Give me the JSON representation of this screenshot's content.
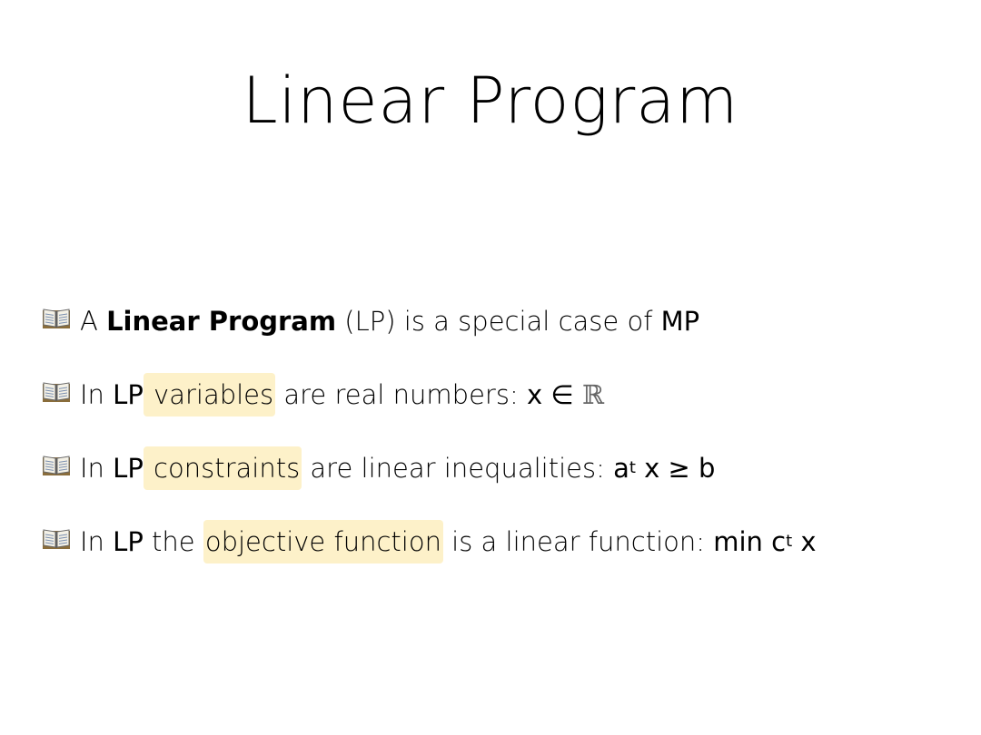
{
  "slide": {
    "title": "Linear Program",
    "bullet_icon": "open-book-icon",
    "highlight_color": "#fdf1c9",
    "bullets": [
      {
        "s1": "A ",
        "s2": "Linear Program",
        "s3": " (LP) is a special case of ",
        "s4": "MP"
      },
      {
        "s1": "In ",
        "s2": "LP",
        "s3": " variables",
        "s4": " are real numbers: ",
        "s5": "x ∈ ",
        "s6": "ℝ"
      },
      {
        "s1": "In ",
        "s2": "LP",
        "s3": " constraints",
        "s4": " are linear inequalities: ",
        "s5": "a",
        "s6": "t",
        "s7": " x ≥ b"
      },
      {
        "s1": "In ",
        "s2": "LP",
        "s3": " the ",
        "s4": "objective function",
        "s5": " is a linear function: ",
        "s6": "min c",
        "s7": "t",
        "s8": " x"
      }
    ]
  }
}
